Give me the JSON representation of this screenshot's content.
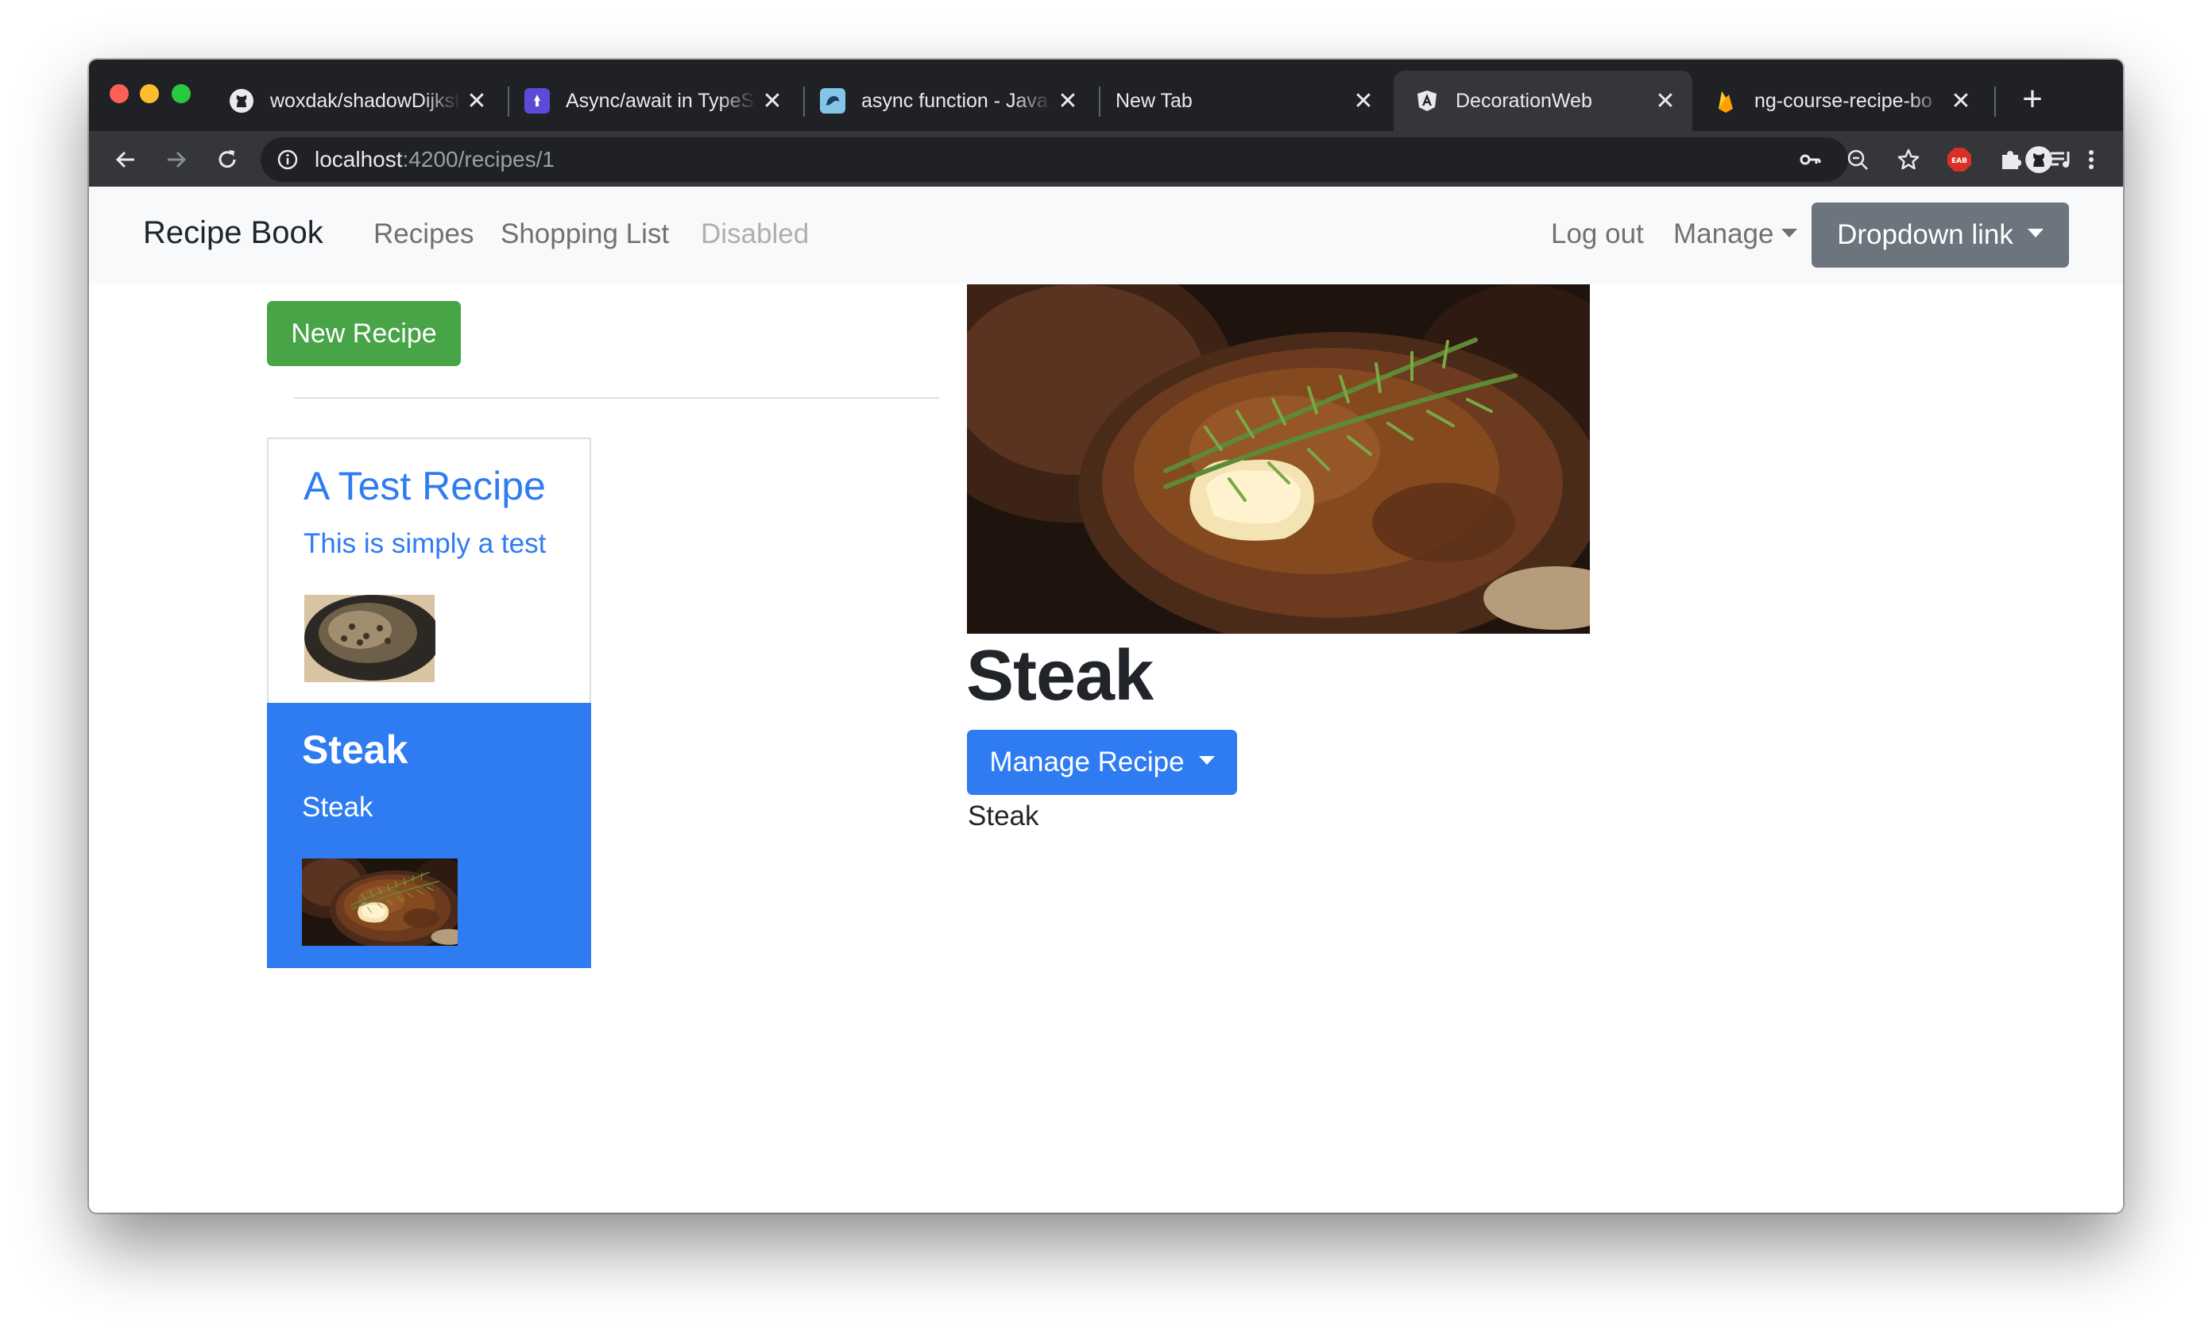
{
  "browser": {
    "tabs": [
      {
        "title": "woxdak/shadowDijkst",
        "favicon": "github-icon",
        "active": false
      },
      {
        "title": "Async/await in TypeSc",
        "favicon": "async-site-icon",
        "active": false
      },
      {
        "title": "async function - Java",
        "favicon": "mdn-icon",
        "active": false
      },
      {
        "title": "New Tab",
        "favicon": "",
        "active": false
      },
      {
        "title": "DecorationWeb",
        "favicon": "angular-icon",
        "active": true
      },
      {
        "title": "ng-course-recipe-bo",
        "favicon": "firebase-icon",
        "active": false
      }
    ],
    "url_host": "localhost",
    "url_rest": ":4200/recipes/1",
    "extension_badge": "EAB",
    "close_glyph": "✕",
    "new_tab_glyph": "+"
  },
  "navbar": {
    "brand": "Recipe Book",
    "links": [
      "Recipes",
      "Shopping List",
      "Disabled"
    ],
    "logout": "Log out",
    "manage": "Manage",
    "dropdown_link": "Dropdown link"
  },
  "recipes": {
    "new_button": "New Recipe",
    "items": [
      {
        "name": "A Test Recipe",
        "description": "This is simply a test",
        "active": false
      },
      {
        "name": "Steak",
        "description": "Steak",
        "active": true
      }
    ]
  },
  "detail": {
    "name": "Steak",
    "manage_button": "Manage Recipe",
    "description": "Steak"
  },
  "colors": {
    "primary": "#2f7cf2",
    "success": "#47a447",
    "secondary": "#6c757d",
    "navbar_bg": "#f8f9fa",
    "tabstrip_bg": "#202124",
    "toolbar_bg": "#35363a"
  }
}
